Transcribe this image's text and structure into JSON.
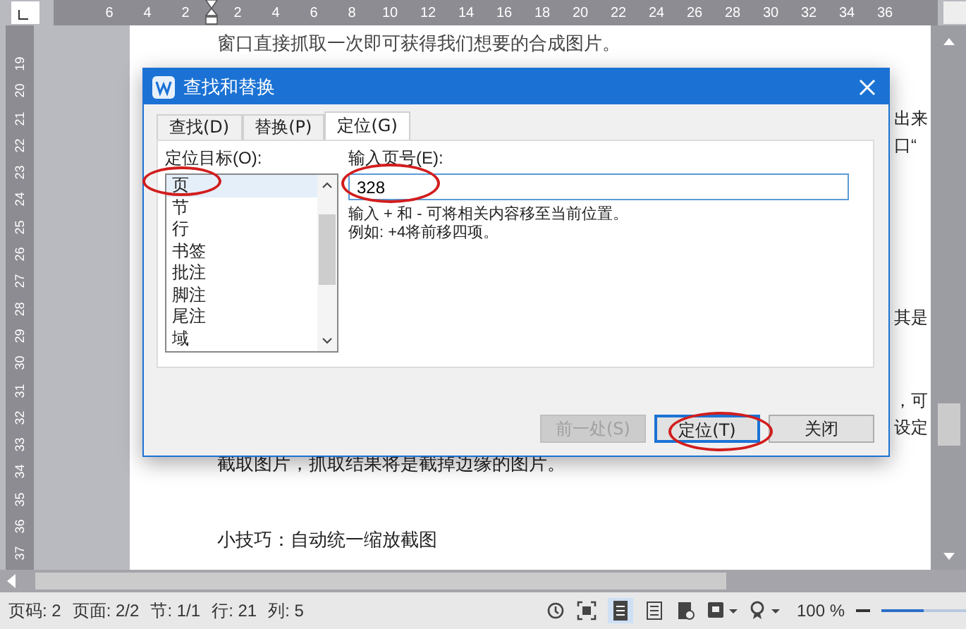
{
  "ruler": {
    "left_of_indent": [
      "6",
      "4",
      "2"
    ],
    "right_of_indent": [
      "2",
      "4",
      "6",
      "8",
      "10",
      "12",
      "14",
      "16",
      "18",
      "20",
      "22",
      "24",
      "26",
      "28",
      "30",
      "32",
      "34",
      "36"
    ],
    "vertical": [
      "19",
      "20",
      "21",
      "22",
      "23",
      "24",
      "25",
      "26",
      "27",
      "28",
      "29",
      "30",
      "31",
      "32",
      "33",
      "34",
      "35",
      "36",
      "37"
    ]
  },
  "document": {
    "top_line": "窗口直接抓取一次即可获得我们想要的合成图片。",
    "right_fragments": [
      "出来",
      "口“",
      "其是",
      "，可",
      "设定"
    ],
    "lines": [
      "截取图片，抓取结果将是截掉边缘的图片。",
      "小技巧：自动统一缩放截图"
    ]
  },
  "dialog": {
    "title": "查找和替换",
    "tabs": [
      {
        "label": "查找(D)",
        "selected": false
      },
      {
        "label": "替换(P)",
        "selected": false
      },
      {
        "label": "定位(G)",
        "selected": true
      }
    ],
    "target_label": "定位目标(O):",
    "targets": [
      {
        "label": "页",
        "selected": true
      },
      {
        "label": "节",
        "selected": false
      },
      {
        "label": "行",
        "selected": false
      },
      {
        "label": "书签",
        "selected": false
      },
      {
        "label": "批注",
        "selected": false
      },
      {
        "label": "脚注",
        "selected": false
      },
      {
        "label": "尾注",
        "selected": false
      },
      {
        "label": "域",
        "selected": false
      }
    ],
    "input_label": "输入页号(E):",
    "input_value": "328",
    "hints": [
      "输入 + 和 - 可将相关内容移至当前位置。",
      "例如: +4将前移四项。"
    ],
    "buttons": [
      {
        "label": "前一处(S)",
        "disabled": true,
        "default": false
      },
      {
        "label": "定位(T)",
        "disabled": false,
        "default": true
      },
      {
        "label": "关闭",
        "disabled": false,
        "default": false
      }
    ]
  },
  "status_bar": {
    "items": [
      "页码: 2",
      "页面: 2/2",
      "节: 1/1",
      "行: 21",
      "列: 5"
    ],
    "zoom": "100 %",
    "zoom_slider": {
      "level": 0.5
    }
  }
}
